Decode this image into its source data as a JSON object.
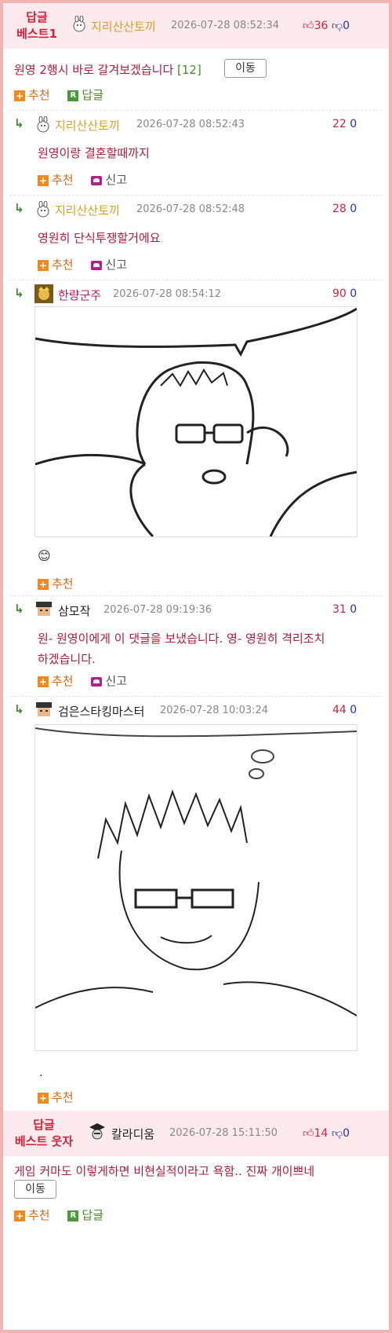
{
  "best1": {
    "badge_line1": "답글",
    "badge_line2": "베스트1",
    "nick": "지리산산토끼",
    "time": "2026-07-28 08:52:34",
    "up": "36",
    "down": "0",
    "text": "원영 2행시 바로 갈겨보겠습니다",
    "reply_count": "[12]",
    "move_label": "이동",
    "recommend_label": "추천",
    "reply_label": "답글"
  },
  "replies": [
    {
      "nick": "지리산산토끼",
      "time": "2026-07-28 08:52:43",
      "up": "22",
      "down": "0",
      "text": "원영이랑 결혼할때까지",
      "recommend_label": "추천",
      "report_label": "신고"
    },
    {
      "nick": "지리산산토끼",
      "time": "2026-07-28 08:52:48",
      "up": "28",
      "down": "0",
      "text": "영원히 단식투쟁할거에요",
      "recommend_label": "추천",
      "report_label": "신고"
    },
    {
      "nick": "한량군주",
      "time": "2026-07-28 08:54:12",
      "up": "90",
      "down": "0",
      "emoji": "😊",
      "recommend_label": "추천"
    },
    {
      "nick": "삼모작",
      "time": "2026-07-28 09:19:36",
      "up": "31",
      "down": "0",
      "text_line1": "원- 원영이에게 이 댓글을 보냈습니다. 영- 영원히 격리조치",
      "text_line2": "하겠습니다.",
      "recommend_label": "추천",
      "report_label": "신고"
    },
    {
      "nick": "검은스타킹마스터",
      "time": "2026-07-28 10:03:24",
      "up": "44",
      "down": "0",
      "text": ".",
      "recommend_label": "추천"
    }
  ],
  "best_funny": {
    "badge_line1": "답글",
    "badge_line2": "베스트 웃자",
    "nick": "칼라디움",
    "time": "2026-07-28 15:11:50",
    "up": "14",
    "down": "0",
    "text": "게임 커마도 이렇게하면 비현실적이라고 욕함.. 진짜 개이쁘네",
    "move_label": "이동",
    "recommend_label": "추천",
    "reply_label": "답글"
  },
  "colors": {
    "accent": "#d4213d",
    "frame": "#f3b3b3",
    "header_bg": "#fdeaec",
    "nick_gold": "#d9a020"
  }
}
